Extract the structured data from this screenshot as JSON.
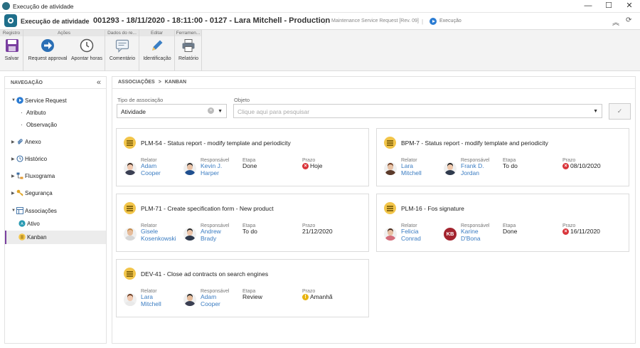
{
  "window": {
    "title": "Execução de atividade",
    "minimize": "—",
    "maximize": "☐",
    "close": "✕"
  },
  "header": {
    "app_name": "Execução de atividade",
    "chevron": "›",
    "record": "001293 - 18/11/2020 - 18:11:00 - 0127 - Lara Mitchell - Production",
    "separator": "|",
    "type": "Maintenance Service Request [Rev. 09]",
    "status": "Execução",
    "collapse": "︽",
    "refresh": "⟳"
  },
  "ribbon": {
    "groups": [
      {
        "label": "Registro"
      },
      {
        "label": "Ações"
      },
      {
        "label": "Dados do re..."
      },
      {
        "label": "Editar"
      },
      {
        "label": "Ferramen..."
      }
    ],
    "buttons": {
      "save": "Salvar",
      "request_approval": "Request approval",
      "log_hours": "Apontar horas",
      "comment": "Comentário",
      "identification": "Identificação",
      "report": "Relatório"
    }
  },
  "sidebar": {
    "title": "NAVEGAÇÃO",
    "collapse": "«",
    "items": [
      {
        "label": "Service Request"
      },
      {
        "label": "Atributo"
      },
      {
        "label": "Observação"
      },
      {
        "label": "Anexo"
      },
      {
        "label": "Histórico"
      },
      {
        "label": "Fluxograma"
      },
      {
        "label": "Segurança"
      },
      {
        "label": "Associações"
      },
      {
        "label": "Ativo"
      },
      {
        "label": "Kanban"
      }
    ]
  },
  "breadcrumb": {
    "parent": "ASSOCIAÇÕES",
    "sep": ">",
    "current": "KANBAN"
  },
  "form": {
    "assoc_type_label": "Tipo de associação",
    "assoc_type_value": "Atividade",
    "object_label": "Objeto",
    "object_placeholder": "Clique aqui para pesquisar",
    "confirm": "✓",
    "clear": "×",
    "caret": "▼"
  },
  "card_labels": {
    "relator": "Relator",
    "responsavel": "Responsável",
    "etapa": "Etapa",
    "prazo": "Prazo"
  },
  "cards": [
    {
      "title": "PLM-54 - Status report - modify template and periodicity",
      "relator": [
        "Adam",
        "Cooper"
      ],
      "responsavel": [
        "Kevin J.",
        "Harper"
      ],
      "etapa": "Done",
      "prazo": "Hoje",
      "prazo_status": "overdue"
    },
    {
      "title": "BPM-7 - Status report - modify template and periodicity",
      "relator": [
        "Lara",
        "Mitchell"
      ],
      "responsavel": [
        "Frank D.",
        "Jordan"
      ],
      "etapa": "To do",
      "prazo": "08/10/2020",
      "prazo_status": "overdue"
    },
    {
      "title": "PLM-71 - Create specification form - New product",
      "relator": [
        "Gisele",
        "Kosenkowski"
      ],
      "responsavel": [
        "Andrew",
        "Brady"
      ],
      "etapa": "To do",
      "prazo": "21/12/2020",
      "prazo_status": "none"
    },
    {
      "title": "PLM-16 - Fos signature",
      "relator": [
        "Felicia",
        "Conrad"
      ],
      "responsavel": [
        "Karine",
        "D'Bona"
      ],
      "responsavel_initials": "KB",
      "etapa": "Done",
      "prazo": "16/11/2020",
      "prazo_status": "overdue"
    },
    {
      "title": "DEV-41 - Close ad contracts on search engines",
      "relator": [
        "Lara",
        "Mitchell"
      ],
      "responsavel": [
        "Adam",
        "Cooper"
      ],
      "etapa": "Review",
      "prazo": "Amanhã",
      "prazo_status": "warning"
    }
  ],
  "colors": {
    "accent": "#2b7cd3",
    "link": "#3a7cc2",
    "overdue": "#d9343a",
    "warning": "#e8b410",
    "kanban_icon": "#f2c54a",
    "active_marker": "#7a3fa0"
  },
  "status_icons": {
    "overdue": "×",
    "warning": "!"
  }
}
